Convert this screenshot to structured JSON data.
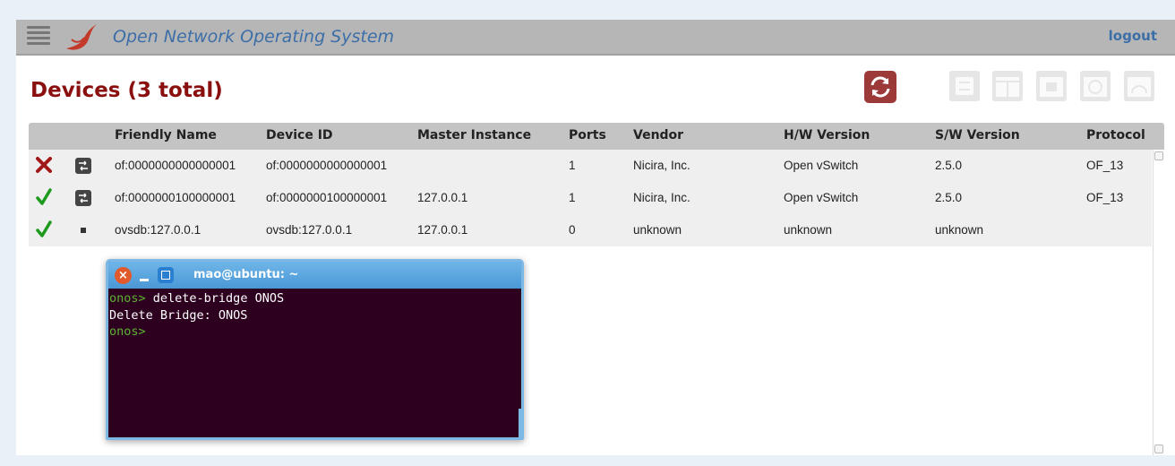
{
  "masthead": {
    "title": "Open Network Operating System",
    "logout_label": "logout",
    "colors": {
      "bar": "#b6b6b6",
      "title": "#3c6ea8",
      "logo": "#c43a2a"
    }
  },
  "page": {
    "title": "Devices (3 total)",
    "title_color": "#8a0f0f"
  },
  "toolbar": {
    "refresh_icon": "refresh-icon",
    "buttons": [
      "switch-icon",
      "table-icon",
      "port-icon",
      "flow-icon",
      "meter-icon"
    ]
  },
  "table": {
    "headers": [
      "Friendly Name",
      "Device ID",
      "Master Instance",
      "Ports",
      "Vendor",
      "H/W Version",
      "S/W Version",
      "Protocol"
    ],
    "rows": [
      {
        "status": "offline",
        "status_icon": "x-icon",
        "type_icon": "switch-icon",
        "friendly_name": "of:0000000000000001",
        "device_id": "of:0000000000000001",
        "master": "",
        "ports": "1",
        "vendor": "Nicira, Inc.",
        "hw": "Open vSwitch",
        "sw": "2.5.0",
        "protocol": "OF_13"
      },
      {
        "status": "online",
        "status_icon": "check-icon",
        "type_icon": "switch-icon",
        "friendly_name": "of:0000000100000001",
        "device_id": "of:0000000100000001",
        "master": "127.0.0.1",
        "ports": "1",
        "vendor": "Nicira, Inc.",
        "hw": "Open vSwitch",
        "sw": "2.5.0",
        "protocol": "OF_13"
      },
      {
        "status": "online",
        "status_icon": "check-icon",
        "type_icon": "device-icon",
        "friendly_name": "ovsdb:127.0.0.1",
        "device_id": "ovsdb:127.0.0.1",
        "master": "127.0.0.1",
        "ports": "0",
        "vendor": "unknown",
        "hw": "unknown",
        "sw": "unknown",
        "protocol": ""
      }
    ]
  },
  "terminal": {
    "title": "mao@ubuntu: ~",
    "lines": [
      {
        "prompt": "onos> ",
        "text": "delete-bridge ONOS"
      },
      {
        "prompt": "",
        "text": "Delete Bridge: ONOS"
      },
      {
        "prompt": "onos> ",
        "text": ""
      }
    ],
    "colors": {
      "background": "#2c001e",
      "prompt": "#5fb236"
    }
  }
}
